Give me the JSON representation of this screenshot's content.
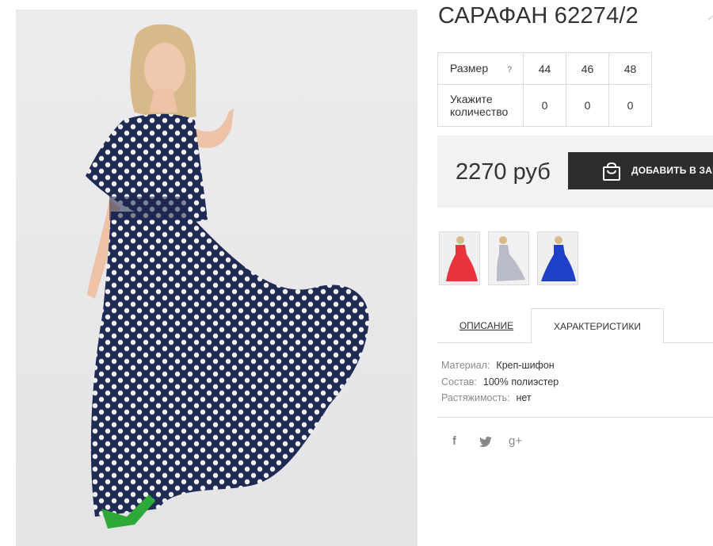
{
  "product": {
    "title": "САРАФАН 62274/2",
    "price": "2270 руб",
    "add_to_cart_label": "ДОБАВИТЬ В ЗАКАЗ",
    "image_alt": "dress-photo"
  },
  "sizes": {
    "header_label": "Размер",
    "help_symbol": "?",
    "quantity_label_line1": "Укажите",
    "quantity_label_line2": "количество",
    "options": [
      {
        "size": "44",
        "qty": "0"
      },
      {
        "size": "46",
        "qty": "0"
      },
      {
        "size": "48",
        "qty": "0"
      }
    ]
  },
  "thumbnails": [
    {
      "name": "red",
      "color": "#e8323c"
    },
    {
      "name": "grey",
      "color": "#b8bcc6"
    },
    {
      "name": "blue",
      "color": "#1e3fc8"
    }
  ],
  "tabs": [
    {
      "label": "ОПИСАНИЕ",
      "active": false
    },
    {
      "label": "ХАРАКТЕРИСТИКИ",
      "active": true
    }
  ],
  "specs": [
    {
      "key": "Материал:",
      "value": "Креп-шифон"
    },
    {
      "key": "Состав:",
      "value": "100% полиэстер"
    },
    {
      "key": "Растяжимость:",
      "value": "нет"
    }
  ],
  "social": {
    "facebook": "f",
    "twitter": "twitter-icon",
    "googleplus": "g+"
  },
  "colors": {
    "button_bg": "#2d2d2d",
    "price_box_bg": "#f2f2f2",
    "dress_navy": "#1f2a55"
  }
}
